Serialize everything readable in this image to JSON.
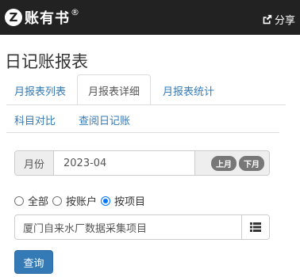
{
  "header": {
    "logo_letter": "Z",
    "app_name": "账有书",
    "registered_mark": "®",
    "share_label": "分享"
  },
  "page": {
    "title": "日记账报表"
  },
  "tabs": [
    {
      "label": "月报表列表",
      "active": false
    },
    {
      "label": "月报表详细",
      "active": true
    },
    {
      "label": "月报表统计",
      "active": false
    },
    {
      "label": "科目对比",
      "active": false
    },
    {
      "label": "查阅日记账",
      "active": false
    }
  ],
  "month": {
    "label": "月份",
    "value": "2023-04",
    "prev_label": "上月",
    "next_label": "下月"
  },
  "filter": {
    "options": [
      {
        "label": "全部",
        "checked": false
      },
      {
        "label": "按账户",
        "checked": false
      },
      {
        "label": "按项目",
        "checked": true
      }
    ]
  },
  "project": {
    "value": "厦门自来水厂数据采集项目"
  },
  "actions": {
    "query_label": "查询"
  },
  "colors": {
    "header_bg": "#222222",
    "link": "#337ab7",
    "primary": "#337ab7",
    "pill": "#777777"
  }
}
